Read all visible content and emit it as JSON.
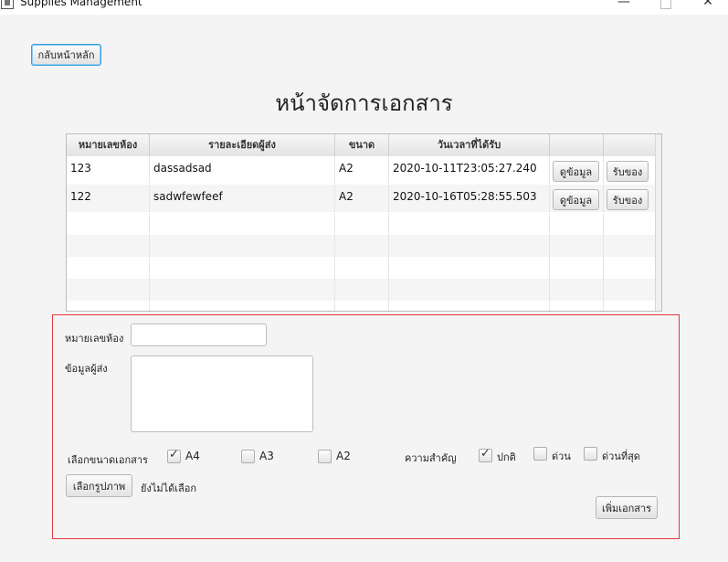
{
  "window": {
    "title": "Supplies Management",
    "min": "—",
    "close": "✕"
  },
  "back_button": "กลับหน้าหลัก",
  "page_title": "หน้าจัดการเอกสาร",
  "table": {
    "headers": [
      "หมายเลขห้อง",
      "รายละเอียดผู้ส่ง",
      "ขนาด",
      "วันเวลาที่ได้รับ",
      "",
      ""
    ],
    "rows": [
      {
        "room": "123",
        "detail": "dassadsad",
        "size": "A2",
        "received": "2020-10-11T23:05:27.240",
        "view": "ดูข้อมูล",
        "receive": "รับของ"
      },
      {
        "room": "122",
        "detail": "sadwfewfeef",
        "size": "A2",
        "received": "2020-10-16T05:28:55.503",
        "view": "ดูข้อมูล",
        "receive": "รับของ"
      }
    ]
  },
  "form": {
    "room_label": "หมายเลขห้อง",
    "room_value": "",
    "sender_label": "ข้อมูลผู้ส่ง",
    "sender_value": "",
    "size_label": "เลือกขนาดเอกสาร",
    "sizes": [
      {
        "label": "A4",
        "checked": true
      },
      {
        "label": "A3",
        "checked": false
      },
      {
        "label": "A2",
        "checked": false
      }
    ],
    "priority_label": "ความสำคัญ",
    "priorities": [
      {
        "label": "ปกติ",
        "checked": true
      },
      {
        "label": "ด่วน",
        "checked": false
      },
      {
        "label": "ด่วนที่สุด",
        "checked": false
      }
    ],
    "choose_image_button": "เลือกรูปภาพ",
    "image_status": "ยังไม่ได้เลือก",
    "add_button": "เพิ่มเอกสาร"
  }
}
